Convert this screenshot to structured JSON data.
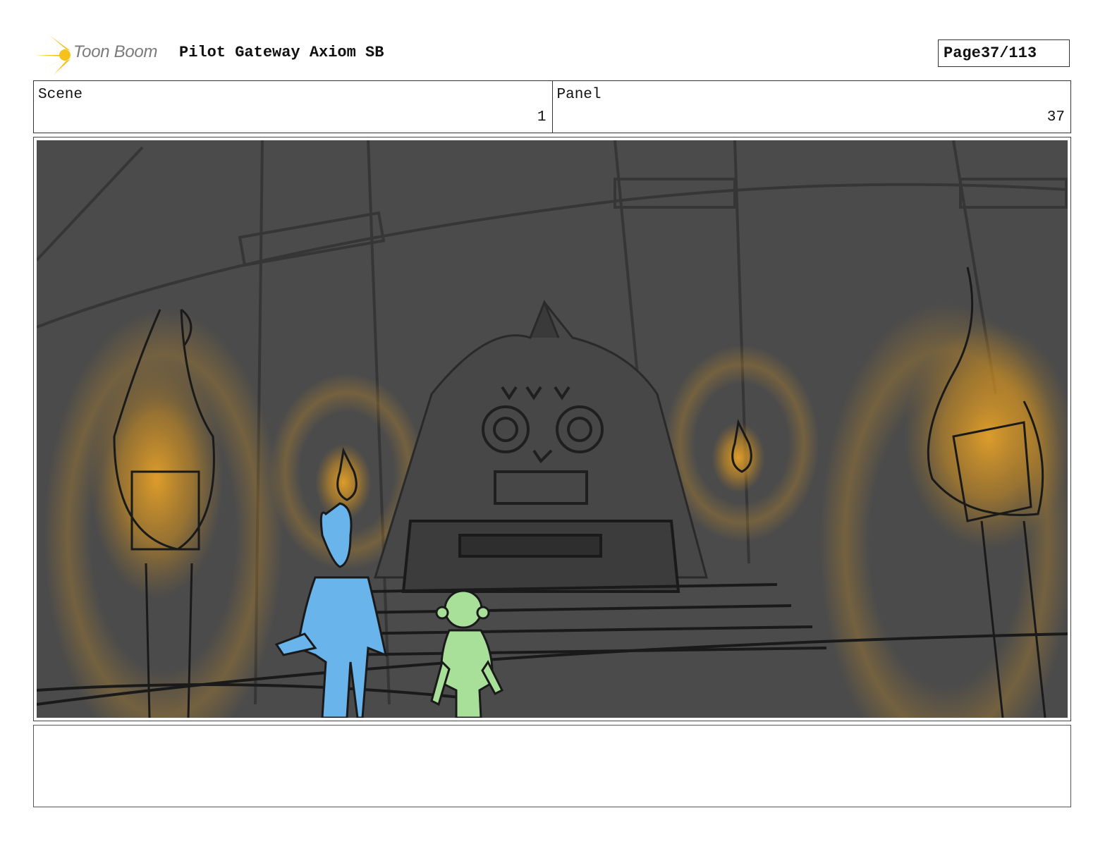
{
  "header": {
    "logo_text": "Toon Boom",
    "project_title": "Pilot Gateway Axiom SB",
    "page_label": "Page",
    "page_value": "37/113"
  },
  "info": {
    "scene_label": "Scene",
    "scene_value": "1",
    "panel_label": "Panel",
    "panel_value": "37"
  },
  "panel": {
    "background_color": "#4a4a4a",
    "torch_glow_color": "#e0a030",
    "character_tall_color": "#6ab4ec",
    "character_small_color": "#a8e09a"
  },
  "notes": {
    "text": ""
  }
}
